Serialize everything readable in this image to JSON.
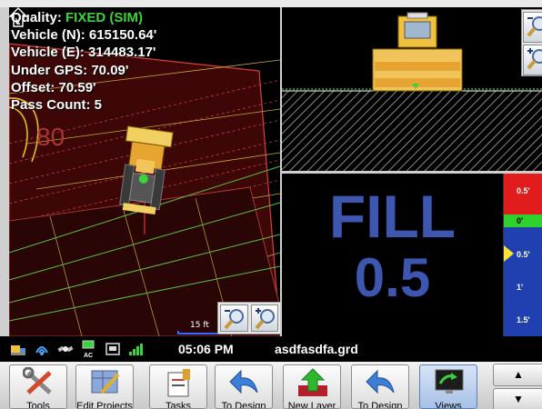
{
  "plan_view": {
    "quality_label": "Quality: ",
    "quality_value": "FIXED (SIM)",
    "vehicle_n": "Vehicle (N): 615150.64'",
    "vehicle_e": "Vehicle (E): 314483.17'",
    "under_gps": "Under GPS: 70.09'",
    "offset": "Offset: 70.59'",
    "pass_count": "Pass Count: 5",
    "contour_label": "80",
    "scale_label": "15 ft",
    "north_icon": "north-arrow-icon",
    "zoom_out_icon": "zoom-out-icon",
    "zoom_in_icon": "zoom-in-icon"
  },
  "profile_view": {
    "zoom_out_icon": "zoom-out-icon",
    "zoom_in_icon": "zoom-in-icon"
  },
  "cut_fill": {
    "label": "FILL",
    "value": "0.5",
    "color": "#3d56b0"
  },
  "lightbar": {
    "ticks": [
      "0.5'",
      "0'",
      "0.5'",
      "1'",
      "1.5'"
    ],
    "cut_color": "#e21c1c",
    "on_grade_color": "#2fd12f",
    "fill_color": "#2140b0",
    "indicator_color": "#f7e23a"
  },
  "status_bar": {
    "icons": [
      "machine-icon",
      "gps-signal-icon",
      "satellite-icon",
      "ac-power-icon",
      "radio-icon",
      "signal-strength-icon"
    ],
    "ac_label": "AC",
    "time": "05:06 PM",
    "file": "asdfasdfa.grd"
  },
  "toolbar": {
    "buttons": [
      {
        "label": "Tools",
        "icon": "tools-icon"
      },
      {
        "label": "Edit Projects",
        "icon": "edit-projects-icon"
      },
      {
        "label": "Tasks",
        "icon": "tasks-icon"
      },
      {
        "label": "To Design",
        "icon": "back-arrow-icon"
      },
      {
        "label": "New Layer",
        "icon": "new-layer-icon"
      },
      {
        "label": "To Design",
        "icon": "back-arrow-icon"
      },
      {
        "label": "Views",
        "icon": "views-icon"
      }
    ],
    "scroll_up": "▲",
    "scroll_down": "▼"
  }
}
